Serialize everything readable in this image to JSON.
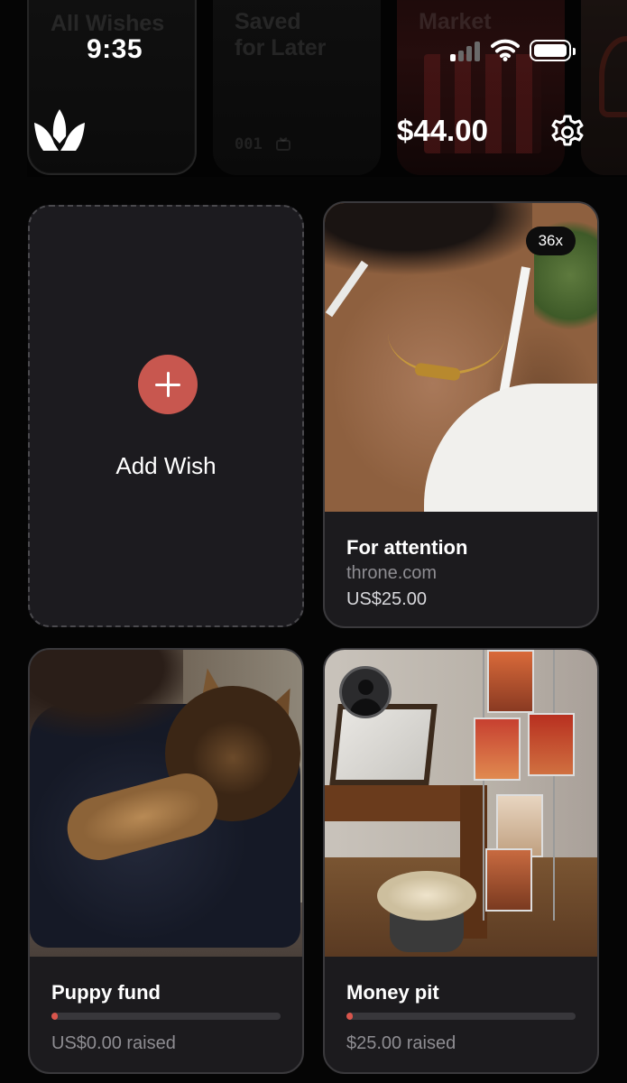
{
  "status_bar": {
    "time": "9:35"
  },
  "categories": [
    {
      "label_line1": "All Wishes",
      "label_line2": "",
      "count": ""
    },
    {
      "label_line1": "Saved",
      "label_line2": "for Later",
      "count": "001"
    },
    {
      "label_line1": "Market",
      "label_line2": "",
      "count": ""
    }
  ],
  "header": {
    "balance": "$44.00"
  },
  "add_wish": {
    "label": "Add Wish"
  },
  "wishes": [
    {
      "title": "For attention",
      "site": "throne.com",
      "price": "US$25.00",
      "badge": "36x"
    },
    {
      "title": "Puppy fund",
      "raised": "US$0.00 raised",
      "progress": 0.0
    },
    {
      "title": "Money pit",
      "raised": "$25.00 raised",
      "progress": 0.0
    }
  ],
  "colors": {
    "accent": "#c8574f",
    "card": "#1c1b1e",
    "background": "#050505"
  },
  "icons": [
    "crown-logo-icon",
    "gear-icon",
    "plus-icon",
    "wifi-icon",
    "battery-icon",
    "cellular-signal-icon",
    "gift-icon",
    "avatar-icon"
  ]
}
